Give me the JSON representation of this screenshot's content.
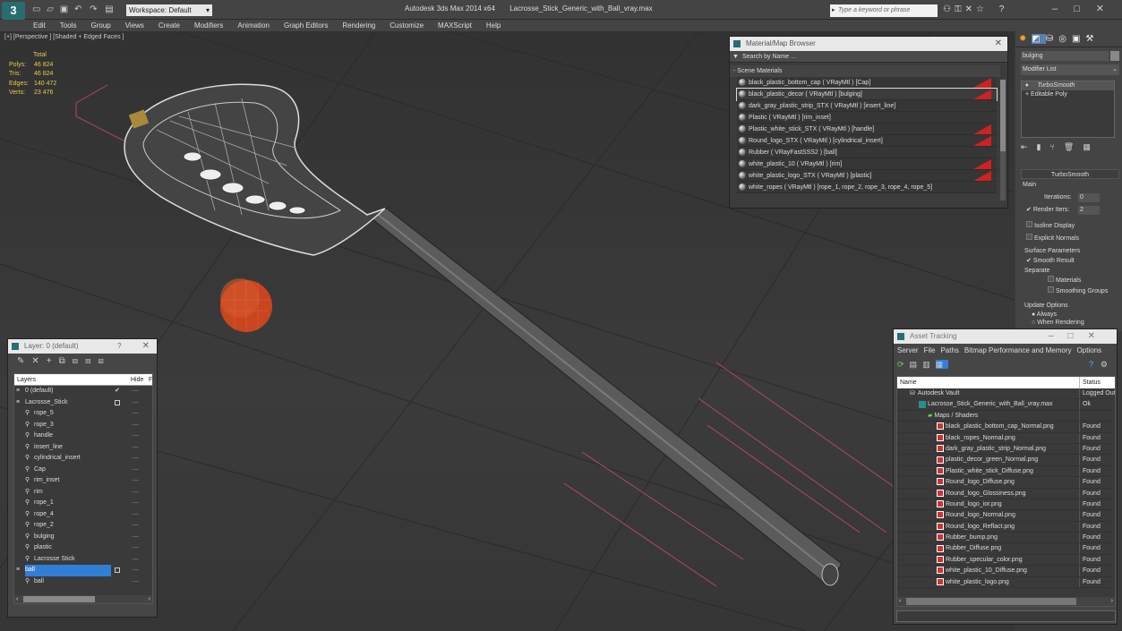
{
  "app": {
    "title": "Autodesk 3ds Max  2014 x64",
    "file": "Lacrosse_Stick_Generic_with_Ball_vray.max",
    "workspace": "Workspace: Default",
    "search_placeholder": "Type a keyword or phrase"
  },
  "menu": [
    "Edit",
    "Tools",
    "Group",
    "Views",
    "Create",
    "Modifiers",
    "Animation",
    "Graph Editors",
    "Rendering",
    "Customize",
    "MAXScript",
    "Help"
  ],
  "viewport": {
    "label": "[+] [Perspective ] [Shaded + Edged Faces ]",
    "stats": {
      "header": "Total",
      "rows": [
        {
          "k": "Polys:",
          "v": "46 824"
        },
        {
          "k": "Tris:",
          "v": "46 824"
        },
        {
          "k": "Edges:",
          "v": "140 472"
        },
        {
          "k": "Verts:",
          "v": "23 476"
        }
      ]
    }
  },
  "material_browser": {
    "title": "Material/Map Browser",
    "search": "Search by Name ...",
    "section": "Scene Materials",
    "items": [
      {
        "label": "black_plastic_bottom_cap  ( VRayMtl ) [Cap]",
        "flag": true
      },
      {
        "label": "black_plastic_decor  ( VRayMtl ) [bulging]",
        "flag": true,
        "selected": true
      },
      {
        "label": "dark_gray_plastic_strip_STX  ( VRayMtl ) [insert_line]",
        "flag": false
      },
      {
        "label": "Plastic  ( VRayMtl ) [rim_inset]",
        "flag": false
      },
      {
        "label": "Plastic_white_stick_STX  ( VRayMtl ) [handle]",
        "flag": true
      },
      {
        "label": "Round_logo_STX  ( VRayMtl ) [cylindrical_insert]",
        "flag": true
      },
      {
        "label": "Rubber  ( VRayFastSSS2 ) [ball]",
        "flag": false
      },
      {
        "label": "white_plastic_10  ( VRayMtl ) [rim]",
        "flag": true
      },
      {
        "label": "white_plastic_logo_STX  ( VRayMtl ) [plastic]",
        "flag": true
      },
      {
        "label": "white_ropes  ( VRayMtl ) [rope_1, rope_2, rope_3, rope_4, rope_5]",
        "flag": false
      }
    ]
  },
  "layers": {
    "title": "Layer: 0 (default)",
    "help": "?",
    "col_layers": "Layers",
    "col_hide": "Hide",
    "col_f": "F",
    "items": [
      {
        "label": "0 (default)",
        "indent": 0,
        "type": "layer",
        "check": true
      },
      {
        "label": "Lacrosse_Stick",
        "indent": 0,
        "type": "layer",
        "box": true
      },
      {
        "label": "rope_5",
        "indent": 1,
        "type": "obj"
      },
      {
        "label": "rope_3",
        "indent": 1,
        "type": "obj"
      },
      {
        "label": "handle",
        "indent": 1,
        "type": "obj"
      },
      {
        "label": "insert_line",
        "indent": 1,
        "type": "obj"
      },
      {
        "label": "cylindrical_insert",
        "indent": 1,
        "type": "obj"
      },
      {
        "label": "Cap",
        "indent": 1,
        "type": "obj"
      },
      {
        "label": "rim_inset",
        "indent": 1,
        "type": "obj"
      },
      {
        "label": "rim",
        "indent": 1,
        "type": "obj"
      },
      {
        "label": "rope_1",
        "indent": 1,
        "type": "obj"
      },
      {
        "label": "rope_4",
        "indent": 1,
        "type": "obj"
      },
      {
        "label": "rope_2",
        "indent": 1,
        "type": "obj"
      },
      {
        "label": "bulging",
        "indent": 1,
        "type": "obj"
      },
      {
        "label": "plastic",
        "indent": 1,
        "type": "obj"
      },
      {
        "label": "Lacrosse Stick",
        "indent": 1,
        "type": "obj"
      },
      {
        "label": "ball",
        "indent": 0,
        "type": "layer",
        "box": true,
        "selected": true
      },
      {
        "label": "ball",
        "indent": 1,
        "type": "obj"
      }
    ]
  },
  "command_panel": {
    "object_name": "bulging",
    "modifier_list": "Modifier List",
    "stack": [
      "TurboSmooth",
      "Editable Poly"
    ],
    "rollout_title": "TurboSmooth",
    "main": "Main",
    "iterations_label": "Iterations:",
    "iterations": "0",
    "render_iters_label": "Render Iters:",
    "render_iters": "2",
    "isoline": "Isoline Display",
    "explicit": "Explicit Normals",
    "surface_params": "Surface Parameters",
    "smooth_result": "Smooth Result",
    "separate": "Separate",
    "materials": "Materials",
    "smoothing_groups": "Smoothing Groups",
    "update_options": "Update Options",
    "always": "Always",
    "when_rendering": "When Rendering"
  },
  "asset_tracking": {
    "title": "Asset Tracking",
    "menu": [
      "Server",
      "File",
      "Paths",
      "Bitmap Performance and Memory",
      "Options"
    ],
    "col_name": "Name",
    "col_status": "Status",
    "rows": [
      {
        "name": "Autodesk Vault",
        "status": "Logged Out",
        "indent": 1,
        "kind": "vault"
      },
      {
        "name": "Lacrosse_Stick_Generic_with_Ball_vray.max",
        "status": "Ok",
        "indent": 2,
        "kind": "max"
      },
      {
        "name": "Maps / Shaders",
        "status": "",
        "indent": 3,
        "kind": "folder"
      },
      {
        "name": "black_plastic_bottom_cap_Normal.png",
        "status": "Found",
        "indent": 4,
        "kind": "png"
      },
      {
        "name": "black_ropes_Normal.png",
        "status": "Found",
        "indent": 4,
        "kind": "png"
      },
      {
        "name": "dark_gray_plastic_strip_Normal.png",
        "status": "Found",
        "indent": 4,
        "kind": "png"
      },
      {
        "name": "plastic_decor_green_Normal.png",
        "status": "Found",
        "indent": 4,
        "kind": "png"
      },
      {
        "name": "Plastic_white_stick_Diffuse.png",
        "status": "Found",
        "indent": 4,
        "kind": "png"
      },
      {
        "name": "Round_logo_Diffuse.png",
        "status": "Found",
        "indent": 4,
        "kind": "png"
      },
      {
        "name": "Round_logo_Glossiness.png",
        "status": "Found",
        "indent": 4,
        "kind": "png"
      },
      {
        "name": "Round_logo_ior.png",
        "status": "Found",
        "indent": 4,
        "kind": "png"
      },
      {
        "name": "Round_logo_Normal.png",
        "status": "Found",
        "indent": 4,
        "kind": "png"
      },
      {
        "name": "Round_logo_Reflact.png",
        "status": "Found",
        "indent": 4,
        "kind": "png"
      },
      {
        "name": "Rubber_bump.png",
        "status": "Found",
        "indent": 4,
        "kind": "png"
      },
      {
        "name": "Rubber_Diffuse.png",
        "status": "Found",
        "indent": 4,
        "kind": "png"
      },
      {
        "name": "Rubber_specular_color.png",
        "status": "Found",
        "indent": 4,
        "kind": "png"
      },
      {
        "name": "white_plastic_10_Diffuse.png",
        "status": "Found",
        "indent": 4,
        "kind": "png"
      },
      {
        "name": "white_plastic_logo.png",
        "status": "Found",
        "indent": 4,
        "kind": "png"
      }
    ]
  },
  "colors": {
    "accent": "#2f7fd6",
    "flag": "#d12020",
    "ball": "#c8451f",
    "stats": "#e8c94a"
  }
}
